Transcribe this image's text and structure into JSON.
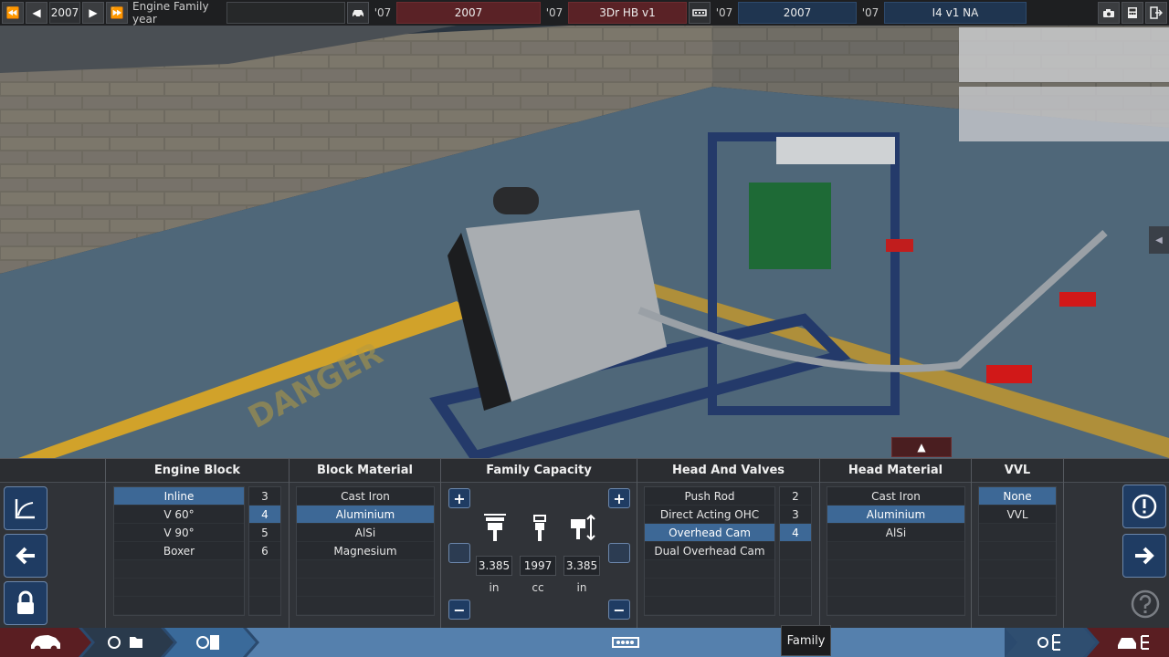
{
  "topbar": {
    "year": "2007",
    "engine_family_label": "Engine Family year",
    "car_year_prefix": "'07",
    "car_year": "2007",
    "car_trim_prefix": "'07",
    "car_trim": "3Dr HB v1",
    "engine_year_prefix": "'07",
    "engine_year": "2007",
    "engine_variant_prefix": "'07",
    "engine_variant": "I4 v1 NA"
  },
  "scene": {
    "floor_text": "DANGER"
  },
  "columns": {
    "engine_block": {
      "title": "Engine Block",
      "layouts": [
        "Inline",
        "V 60°",
        "V 90°",
        "Boxer"
      ],
      "selected_layout": 0,
      "cylinders": [
        "3",
        "4",
        "5",
        "6"
      ],
      "selected_cylinders": 1
    },
    "block_material": {
      "title": "Block Material",
      "options": [
        "Cast Iron",
        "Aluminium",
        "AlSi",
        "Magnesium"
      ],
      "selected": 1
    },
    "family_capacity": {
      "title": "Family Capacity",
      "bore_value": "3.385",
      "bore_unit": "in",
      "displacement_value": "1997",
      "displacement_unit": "cc",
      "stroke_value": "3.385",
      "stroke_unit": "in",
      "plus": "+",
      "minus": "−"
    },
    "head_and_valves": {
      "title": "Head And Valves",
      "options": [
        "Push Rod",
        "Direct Acting OHC",
        "Overhead Cam",
        "Dual Overhead Cam"
      ],
      "selected": 2,
      "valves": [
        "2",
        "3",
        "4"
      ],
      "selected_valves": 2
    },
    "head_material": {
      "title": "Head Material",
      "options": [
        "Cast Iron",
        "Aluminium",
        "AlSi"
      ],
      "selected": 1
    },
    "vvl": {
      "title": "VVL",
      "options": [
        "None",
        "VVL"
      ],
      "selected": 0
    }
  },
  "nav": {
    "family_label": "Family"
  },
  "colors": {
    "accent_blue": "#3d6896",
    "panel_bg": "#303338",
    "nav_blue": "#2b4a6e",
    "car_red": "#5a2226"
  }
}
